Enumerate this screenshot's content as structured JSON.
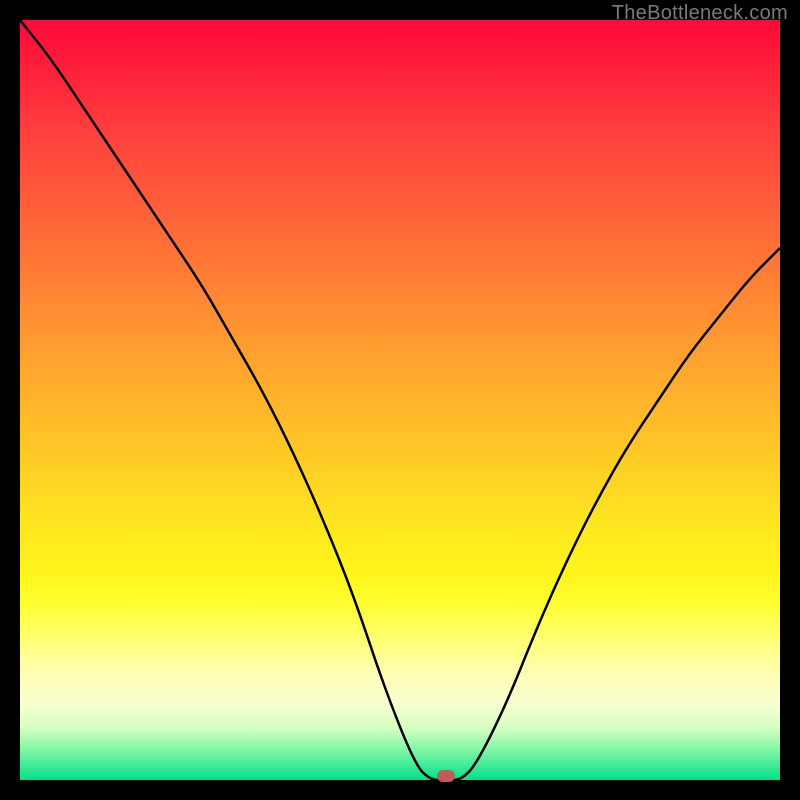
{
  "watermark": "TheBottleneck.com",
  "colors": {
    "frame": "#000000",
    "curve": "#000000",
    "marker": "#c65a5a"
  },
  "chart_data": {
    "type": "line",
    "title": "",
    "xlabel": "",
    "ylabel": "",
    "xlim": [
      0,
      100
    ],
    "ylim": [
      0,
      100
    ],
    "grid": false,
    "legend": false,
    "series": [
      {
        "name": "bottleneck-curve",
        "x": [
          0,
          4,
          8,
          12,
          16,
          20,
          24,
          28,
          32,
          36,
          40,
          44,
          48,
          52,
          54,
          56,
          58,
          60,
          64,
          68,
          72,
          76,
          80,
          84,
          88,
          92,
          96,
          100
        ],
        "values": [
          100,
          95,
          89,
          83,
          77,
          71,
          65,
          58,
          51,
          43,
          34,
          24,
          12,
          2,
          0,
          0,
          0,
          2,
          10,
          20,
          29,
          37,
          44,
          50,
          56,
          61,
          66,
          70
        ]
      }
    ],
    "annotations": [
      {
        "name": "optimum-marker",
        "x": 56,
        "y": 0
      }
    ]
  }
}
